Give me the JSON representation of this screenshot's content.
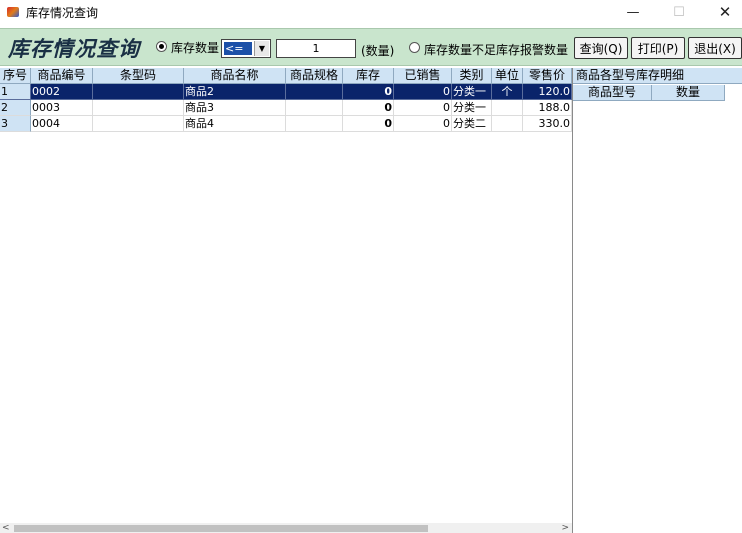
{
  "window": {
    "title": "库存情况查询",
    "minimize": "—",
    "maximize": "☐",
    "close": "✕"
  },
  "header": {
    "big_title": "库存情况查询",
    "radio_stock_label": "库存数量",
    "operator_value": "<=",
    "dropdown_arrow": "▼",
    "quantity_value": "1",
    "quantity_unit": "(数量)",
    "radio_alarm_label": "库存数量不足库存报警数量",
    "query_button": "查询(Q)",
    "print_button": "打印(P)",
    "exit_button": "退出(X)"
  },
  "grid": {
    "columns": [
      "序号",
      "商品编号",
      "条型码",
      "商品名称",
      "商品规格",
      "库存",
      "已销售",
      "类别",
      "单位",
      "零售价"
    ],
    "rows": [
      {
        "no": "1",
        "code": "0002",
        "barcode": "",
        "name": "商品2",
        "spec": "",
        "stock": "0",
        "sold": "0",
        "category": "分类一",
        "unit": "个",
        "price": "120.0"
      },
      {
        "no": "2",
        "code": "0003",
        "barcode": "",
        "name": "商品3",
        "spec": "",
        "stock": "0",
        "sold": "0",
        "category": "分类一",
        "unit": "",
        "price": "188.0"
      },
      {
        "no": "3",
        "code": "0004",
        "barcode": "",
        "name": "商品4",
        "spec": "",
        "stock": "0",
        "sold": "0",
        "category": "分类二",
        "unit": "",
        "price": "330.0"
      }
    ]
  },
  "right_panel": {
    "title": "商品各型号库存明细",
    "columns": [
      "商品型号",
      "数量"
    ]
  },
  "scrollbar": {
    "left_arrow": "<",
    "right_arrow": ">"
  }
}
